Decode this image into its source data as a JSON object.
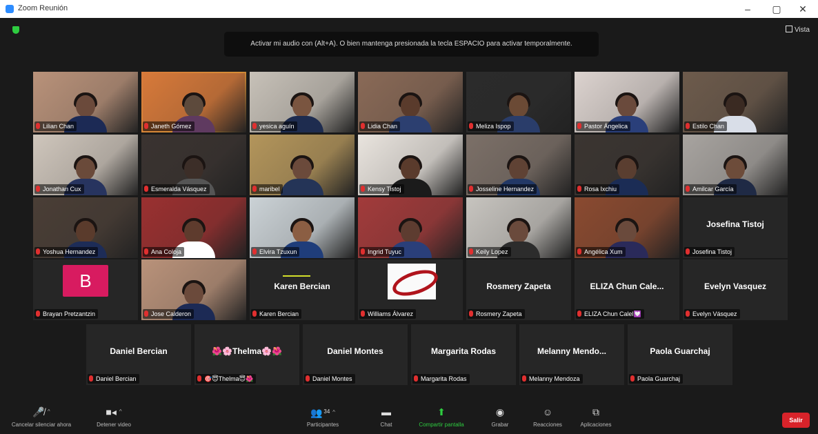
{
  "window": {
    "title": "Zoom Reunión",
    "minimize": "–",
    "maximize": "▢",
    "close": "✕"
  },
  "top": {
    "view_label": "Vista",
    "tooltip": "Activar mi audio con (Alt+A). O bien mantenga presionada la tecla ESPACIO para activar temporalmente."
  },
  "participants": {
    "row1": [
      "Lilian Chan",
      "Janeth Gómez",
      "yesica aguín",
      "Lidia Chan",
      "Meliza Ispop",
      "Pastor Ángelica",
      "Estilo Chan"
    ],
    "row2": [
      "Jonathan Cux",
      "Esmeralda Vásquez",
      "maribel",
      "Kensy Tistoj",
      "Josseline Hernandez",
      "Rosa Ixchiu",
      "Amilcar García"
    ],
    "row3": [
      "Yoshua Hernandez",
      "Ana Coloja",
      "Elvira Tzuxun",
      "Ingrid Tuyuc",
      "Keily Lopez",
      "Angélica Xum",
      "Josefina Tistoj"
    ],
    "row3_bigname": "Josefina Tistoj",
    "row4": [
      {
        "label": "Brayan Pretzantzin",
        "avatar_letter": "B"
      },
      {
        "label": "Jose Calderon"
      },
      {
        "label": "Karen Bercian",
        "big": "Karen Bercian"
      },
      {
        "label": "Williams Álvarez"
      },
      {
        "label": "Rosmery Zapeta",
        "big": "Rosmery  Zapeta"
      },
      {
        "label": "ELIZA Chun Calel💟",
        "big": "ELIZA Chun Cale..."
      },
      {
        "label": "Evelyn Vásquez",
        "big": "Evelyn Vasquez"
      }
    ],
    "row5": [
      {
        "big": "Daniel Bercian",
        "label": "Daniel Bercian"
      },
      {
        "big": "🌺🌸Thelma🌸🌺",
        "label": "🎯😇Thelma😇🌺"
      },
      {
        "big": "Daniel Montes",
        "label": "Daniel Montes"
      },
      {
        "big": "Margarita Rodas",
        "label": "Margarita Rodas"
      },
      {
        "big": "Melanny  Mendo...",
        "label": "Melanny Mendoza"
      },
      {
        "big": "Paola Guarchaj",
        "label": "Paola Guarchaj"
      }
    ]
  },
  "toolbar": {
    "unmute": "Cancelar silenciar ahora",
    "stop_video": "Detener video",
    "participants": "Participantes",
    "participants_count": "34",
    "chat": "Chat",
    "share": "Compartir pantalla",
    "record": "Grabar",
    "reactions": "Reacciones",
    "apps": "Aplicaciones",
    "leave": "Salir"
  },
  "colors": {
    "speaking_border": "#d4e02a",
    "leave": "#d8232a",
    "share_green": "#2ecc40",
    "avatar_b": "#d81b60"
  }
}
